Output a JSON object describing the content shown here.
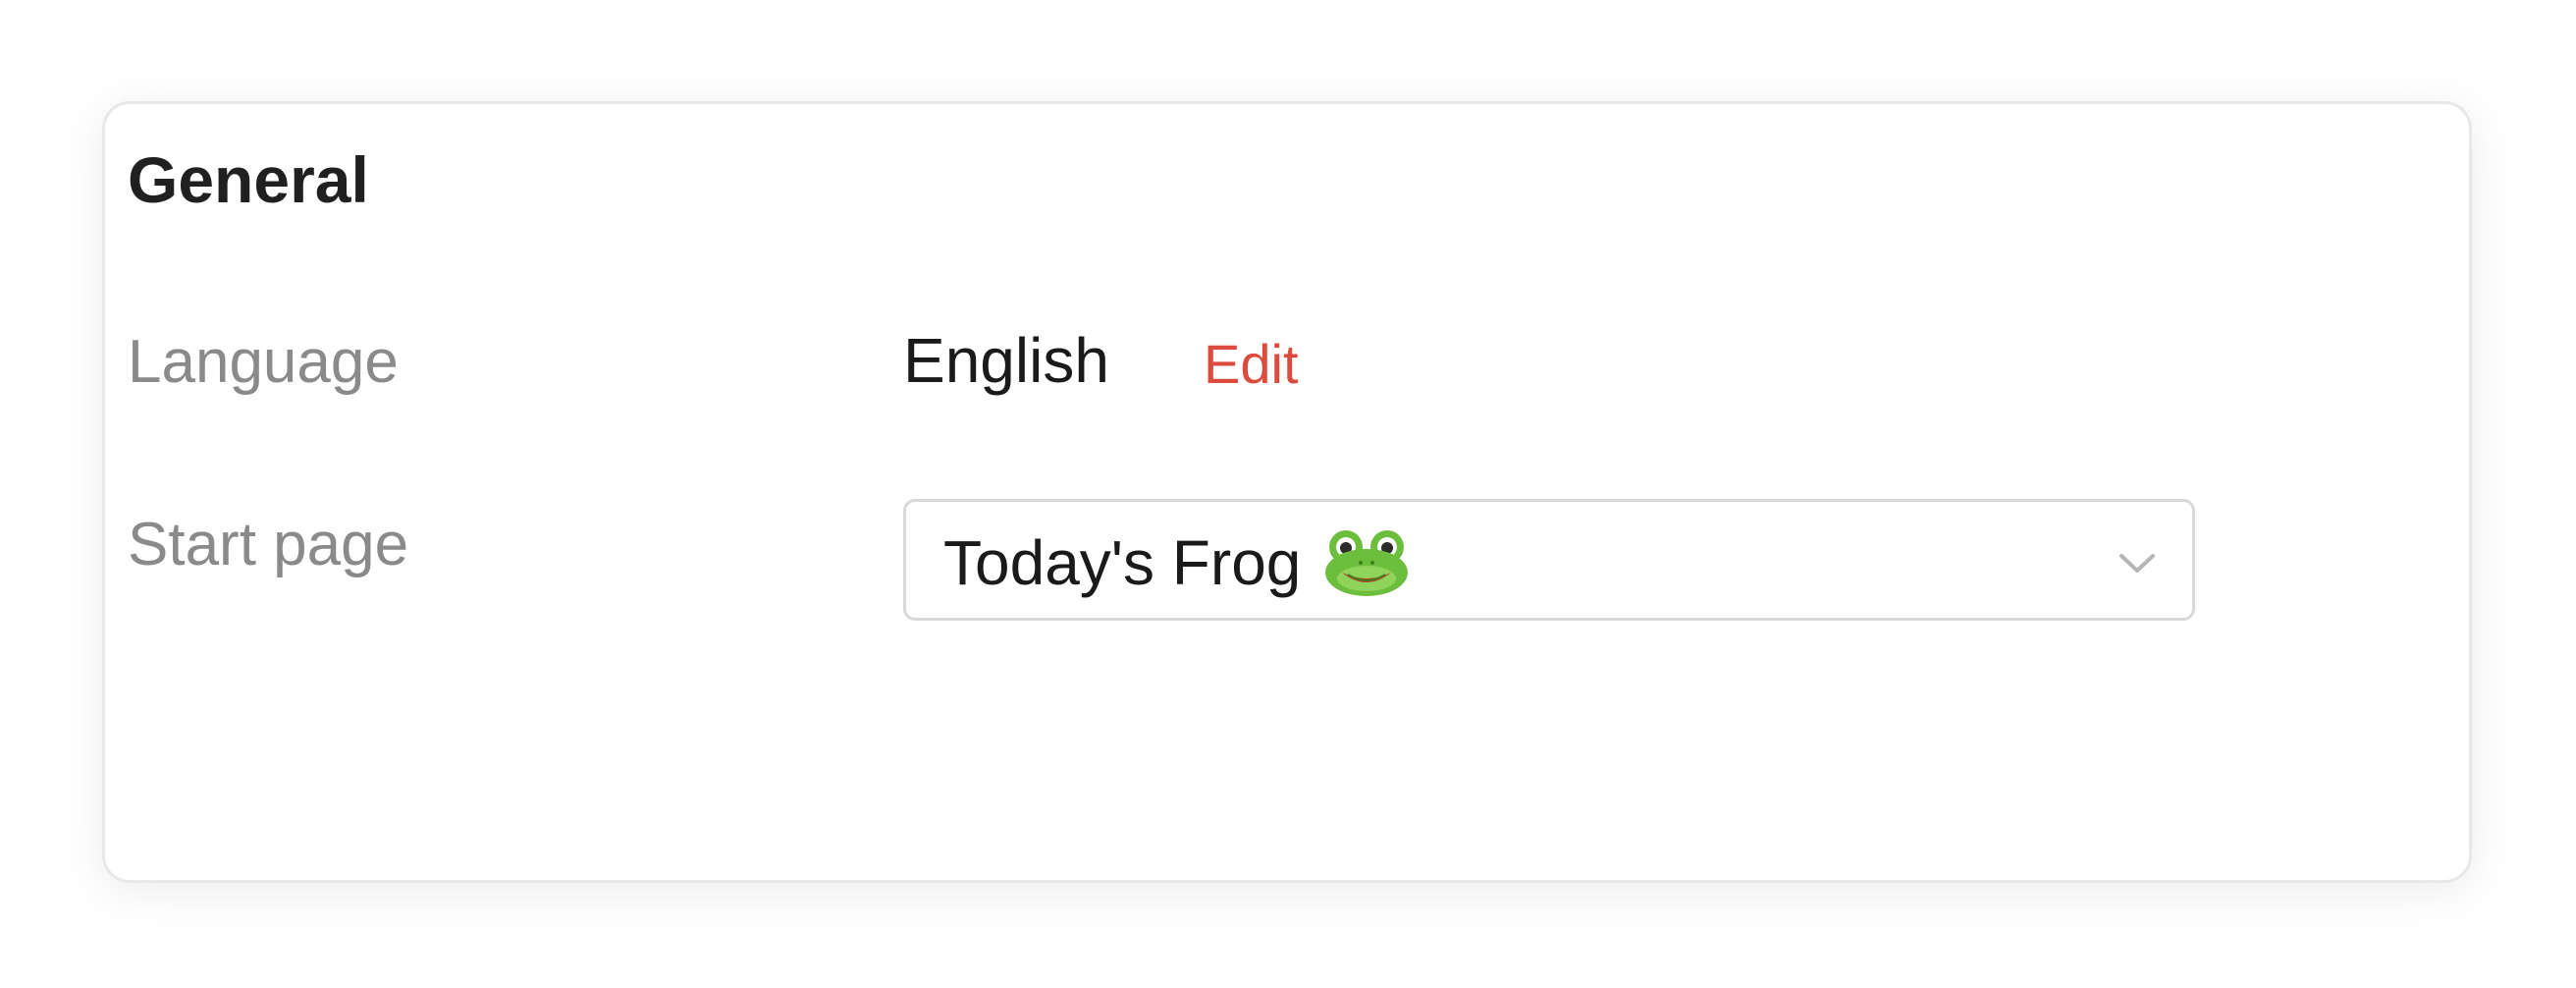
{
  "general": {
    "title": "General",
    "language": {
      "label": "Language",
      "value": "English",
      "edit_label": "Edit"
    },
    "start_page": {
      "label": "Start page",
      "selected": "Today's Frog",
      "icon": "frog-icon"
    }
  },
  "colors": {
    "accent": "#dc4c3e",
    "label": "#8a8a8a",
    "text": "#1a1a1a",
    "border": "#d9d9d9"
  }
}
